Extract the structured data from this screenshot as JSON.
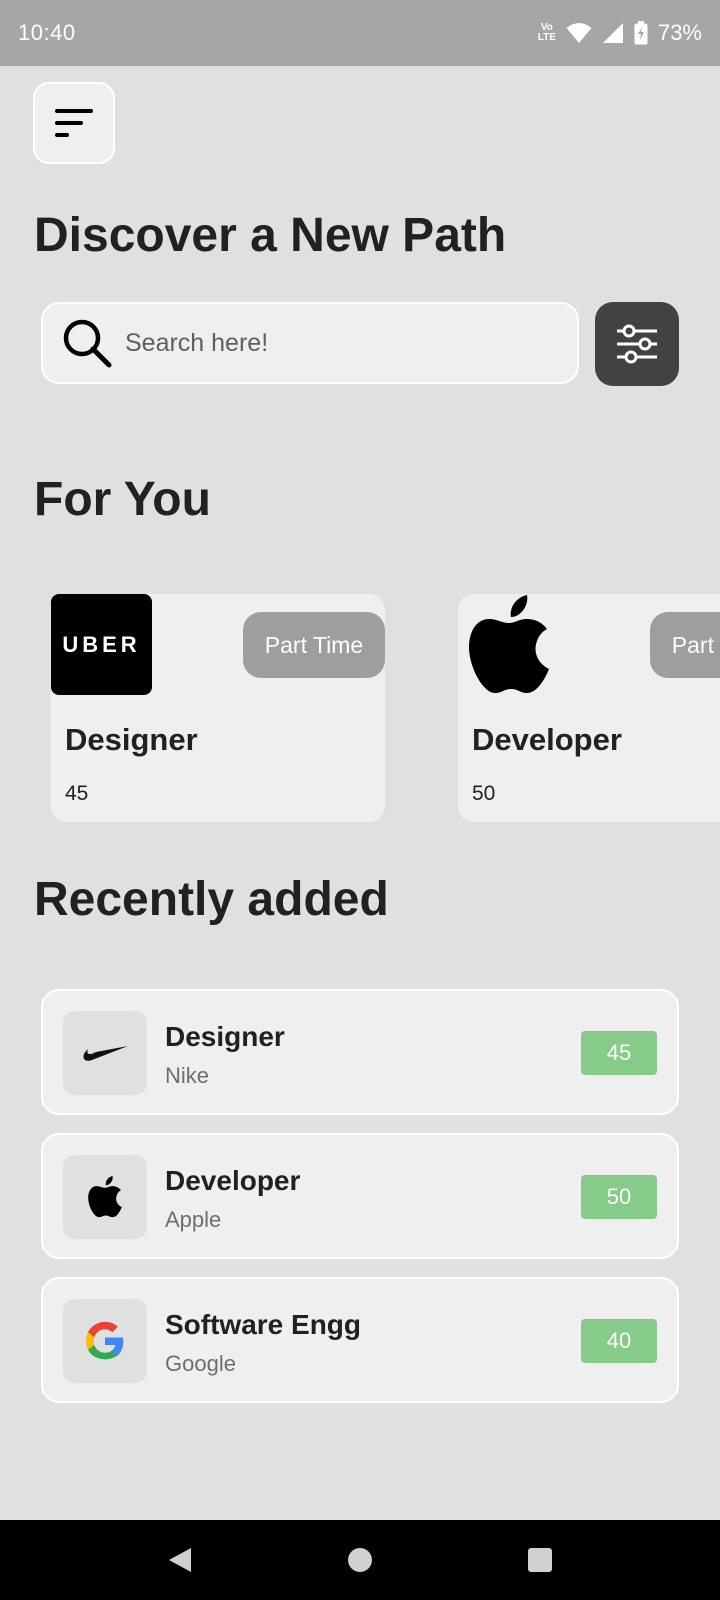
{
  "status_bar": {
    "time": "10:40",
    "volte_top": "Vo",
    "volte_bottom": "LTE",
    "battery": "73%"
  },
  "header": {
    "title": "Discover a New Path"
  },
  "search": {
    "placeholder": "Search here!"
  },
  "for_you": {
    "title": "For You",
    "cards": [
      {
        "company_logo": "UBER",
        "badge": "Part Time",
        "title": "Designer",
        "count": "45"
      },
      {
        "company_logo": "apple-logo",
        "badge": "Part Time",
        "title": "Developer",
        "count": "50"
      }
    ]
  },
  "recent": {
    "title": "Recently added",
    "items": [
      {
        "title": "Designer",
        "company": "Nike",
        "count": "45",
        "icon": "nike-logo"
      },
      {
        "title": "Developer",
        "company": "Apple",
        "count": "50",
        "icon": "apple-logo"
      },
      {
        "title": "Software Engg",
        "company": "Google",
        "count": "40",
        "icon": "google-logo"
      }
    ]
  },
  "colors": {
    "background": "#e0e0e0",
    "card": "#efefef",
    "badge": "#9e9e9e",
    "count_badge": "#86cc88",
    "filter_button": "#424242"
  }
}
